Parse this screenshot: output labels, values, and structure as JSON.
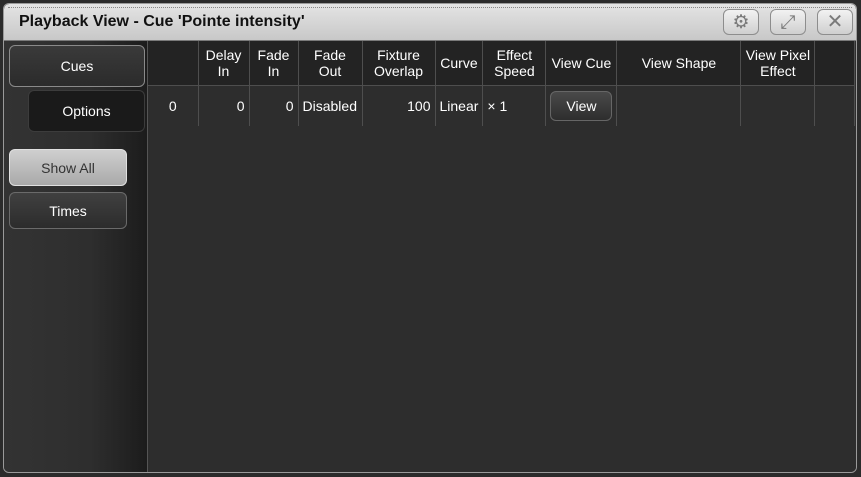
{
  "window": {
    "title": "Playback View - Cue 'Pointe intensity'",
    "buttons": {
      "settings": "⚙",
      "maximize": "⤢",
      "close": "✕"
    }
  },
  "sidebar": {
    "tabs": {
      "cues": "Cues",
      "options": "Options"
    },
    "buttons": {
      "show_all": "Show All",
      "times": "Times"
    }
  },
  "table": {
    "headers": {
      "cue": "",
      "delay_in": "Delay\nIn",
      "fade_in": "Fade\nIn",
      "fade_out": "Fade\nOut",
      "fixture_overlap": "Fixture\nOverlap",
      "curve": "Curve",
      "effect_speed": "Effect\nSpeed",
      "view_cue": "View Cue",
      "view_shape": "View Shape",
      "view_pixel_effect": "View Pixel\nEffect"
    },
    "rows": [
      {
        "cue": "0",
        "delay_in": "0",
        "fade_in": "0",
        "fade_out": "Disabled",
        "fixture_overlap": "100",
        "curve": "Linear",
        "effect_speed": "× 1",
        "view_cue": "View",
        "view_shape": "",
        "view_pixel_effect": ""
      }
    ]
  }
}
